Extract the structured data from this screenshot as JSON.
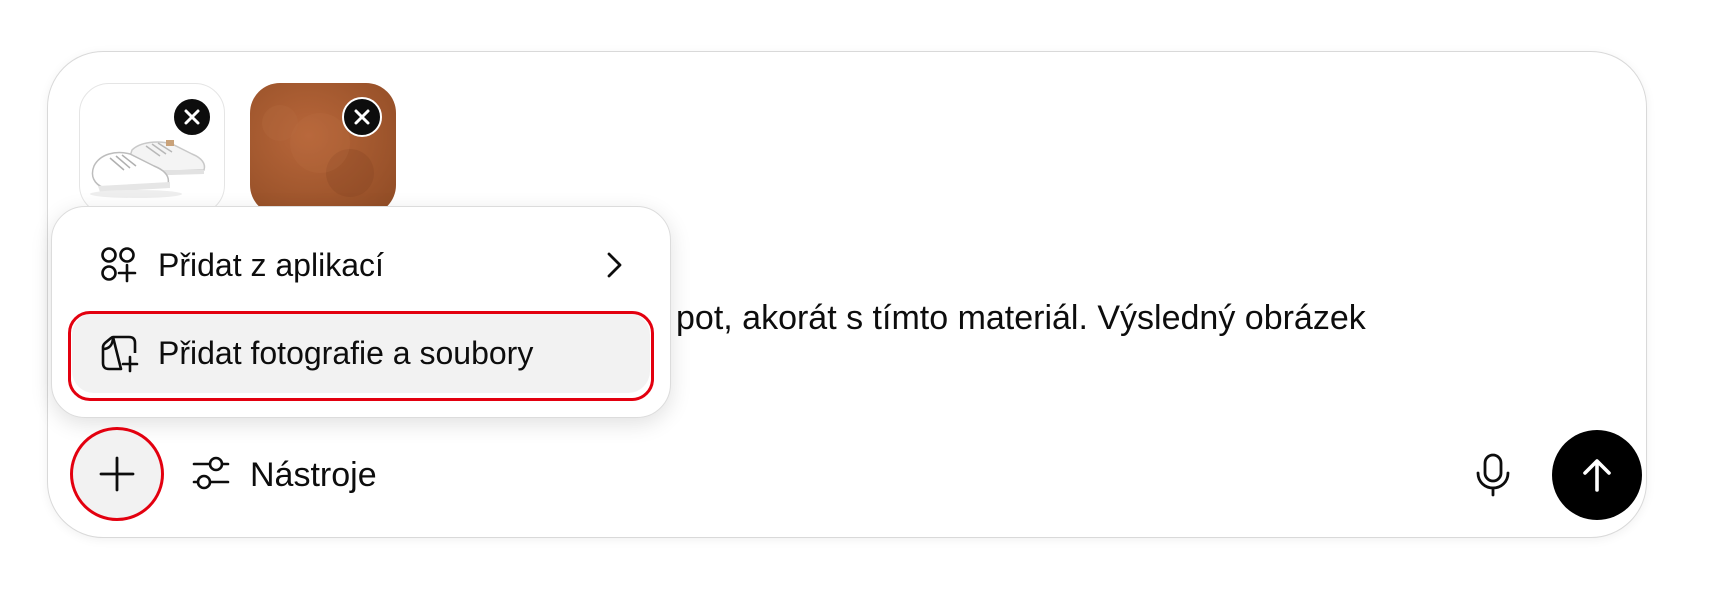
{
  "attachments": [
    {
      "name": "white-sneakers-image",
      "remove_icon": "close-icon"
    },
    {
      "name": "brown-leather-texture-image",
      "remove_icon": "close-icon"
    }
  ],
  "prompt": {
    "visible_text": "pot, akorát s tímto materiál. Výsledný obrázek"
  },
  "menu": {
    "items": [
      {
        "label": "Přidat z aplikací",
        "icon": "apps-icon",
        "has_submenu": true
      },
      {
        "label": "Přidat fotografie a soubory",
        "icon": "add-file-icon",
        "highlighted": true
      }
    ]
  },
  "toolbar": {
    "plus_icon": "plus-icon",
    "tools_label": "Nástroje",
    "tools_icon": "sliders-icon",
    "mic_icon": "microphone-icon",
    "send_icon": "arrow-up-icon"
  },
  "colors": {
    "highlight": "#e3000f",
    "send_button": "#000000",
    "menu_item_active": "#f2f2f2"
  }
}
